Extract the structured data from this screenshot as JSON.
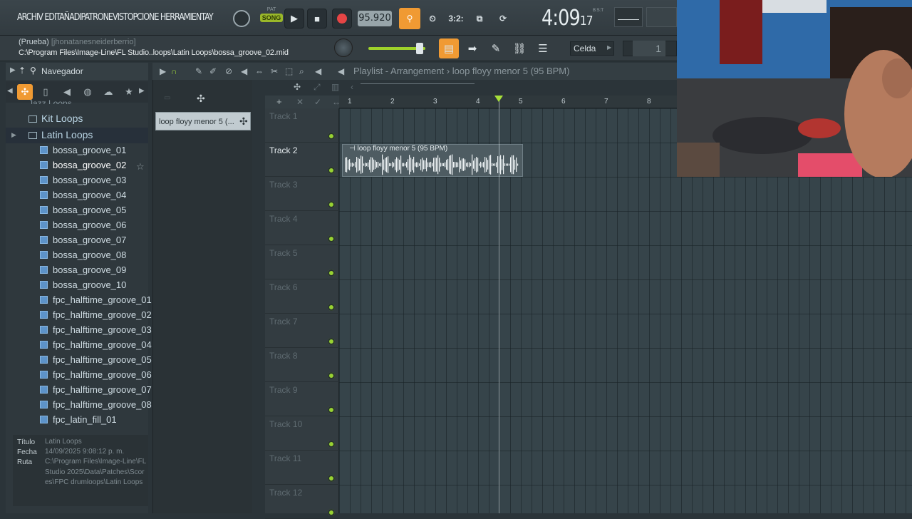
{
  "menu": {
    "text": "ARCHIV EDITAÑADIPATRONEVISTOPCIONE HERRAMIENTAY"
  },
  "transport": {
    "pat_label": "PAT",
    "song_label": "SONG",
    "tempo": "95.920",
    "time": "4:09",
    "time_frac": "17",
    "time_unit": "B:S:T"
  },
  "toolbar_icons": [
    "typing-icon",
    "wait-icon",
    "counter-3.2-icon",
    "loop-record-icon",
    "metronome-icon"
  ],
  "counter_label": "3:2:",
  "hint": {
    "line1_prefix": "(Prueba)",
    "line1_user": "[jhonatanesneiderberrio]",
    "line2": "C:\\Program Files\\Image-Line\\FL Studio..loops\\Latin Loops\\bossa_groove_02.mid"
  },
  "snap": {
    "value": "Celda"
  },
  "pattern_number": "1",
  "browser": {
    "title": "Navegador",
    "partial_folder": "Jazz Loops",
    "folders": [
      "Kit Loops",
      "Latin Loops"
    ],
    "files": [
      "bossa_groove_01",
      "bossa_groove_02",
      "bossa_groove_03",
      "bossa_groove_04",
      "bossa_groove_05",
      "bossa_groove_06",
      "bossa_groove_07",
      "bossa_groove_08",
      "bossa_groove_09",
      "bossa_groove_10",
      "fpc_halftime_groove_01",
      "fpc_halftime_groove_02",
      "fpc_halftime_groove_03",
      "fpc_halftime_groove_04",
      "fpc_halftime_groove_05",
      "fpc_halftime_groove_06",
      "fpc_halftime_groove_07",
      "fpc_halftime_groove_08",
      "fpc_latin_fill_01"
    ],
    "selected_file": "bossa_groove_02",
    "info": {
      "title_label": "Título",
      "title_value": "Latin Loops",
      "date_label": "Fecha",
      "date_value": "14/09/2025 9:08:12 p. m.",
      "path_label": "Ruta",
      "path_value": "C:\\Program Files\\Image-Line\\FL Studio 2025\\Data\\Patches\\Scores\\FPC drumloops\\Latin Loops"
    }
  },
  "picker": {
    "clip_name": "loop floyy menor 5 (..."
  },
  "playlist": {
    "title": "Playlist - Arrangement",
    "pattern": "loop floyy menor 5 (95 BPM)",
    "bars": [
      "1",
      "2",
      "3",
      "4",
      "5",
      "6",
      "7",
      "8"
    ],
    "tracks": [
      "Track 1",
      "Track 2",
      "Track 3",
      "Track 4",
      "Track 5",
      "Track 6",
      "Track 7",
      "Track 8",
      "Track 9",
      "Track 10",
      "Track 11",
      "Track 12"
    ],
    "active_track_index": 1,
    "clip": {
      "label": "loop floyy menor 5 (95 BPM)",
      "track_index": 1,
      "start_bar": 1,
      "length_bars": 4.2
    },
    "playhead_bar": 4.5
  },
  "colors": {
    "accent_orange": "#f09a33",
    "song_green": "#9ab829",
    "record_red": "#e64545",
    "led_green": "#98d232"
  }
}
